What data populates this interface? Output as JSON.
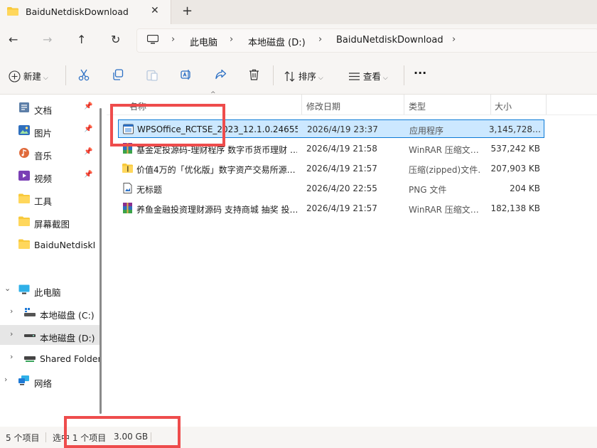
{
  "tab": {
    "title": "BaiduNetdiskDownload",
    "close": "✕",
    "new": "+"
  },
  "nav": {
    "back": "←",
    "forward": "→",
    "up": "↑",
    "refresh": "↻",
    "breadcrumbs": [
      "此电脑",
      "本地磁盘 (D:)",
      "BaiduNetdiskDownload"
    ],
    "sep": "›"
  },
  "toolbar": {
    "new_label": "新建",
    "sort_label": "排序",
    "view_label": "查看",
    "more": "···"
  },
  "sidebar": {
    "quick": [
      {
        "label": "文档",
        "icon": "documents-icon",
        "pinned": true
      },
      {
        "label": "图片",
        "icon": "pictures-icon",
        "pinned": true
      },
      {
        "label": "音乐",
        "icon": "music-icon",
        "pinned": true
      },
      {
        "label": "视频",
        "icon": "videos-icon",
        "pinned": true
      },
      {
        "label": "工具",
        "icon": "folder-icon",
        "pinned": false
      },
      {
        "label": "屏幕截图",
        "icon": "folder-icon",
        "pinned": false
      },
      {
        "label": "BaiduNetdiskDownload",
        "icon": "folder-icon",
        "pinned": false
      }
    ],
    "this_pc": "此电脑",
    "drives": [
      {
        "label": "本地磁盘 (C:)",
        "icon": "drive-c-icon"
      },
      {
        "label": "本地磁盘 (D:)",
        "icon": "drive-d-icon",
        "selected": true
      },
      {
        "label": "Shared Folders",
        "icon": "network-drive-icon"
      }
    ],
    "network": "网络"
  },
  "columns": {
    "name": "名称",
    "modified": "修改日期",
    "type": "类型",
    "size": "大小"
  },
  "files": [
    {
      "name": "WPSOffice_RCTSE_2023_12.1.0.24655_…",
      "modified": "2026/4/19 23:37",
      "type": "应用程序",
      "size": "3,145,728…",
      "icon": "exe-icon",
      "selected": true
    },
    {
      "name": "基金定投源码-理财程序 数字币货币理财 …",
      "modified": "2026/4/19 21:58",
      "type": "WinRAR 压缩文…",
      "size": "537,242 KB",
      "icon": "winrar-icon"
    },
    {
      "name": "价值4万的「优化版」数字资产交易所源…",
      "modified": "2026/4/19 21:57",
      "type": "压缩(zipped)文件…",
      "size": "207,903 KB",
      "icon": "zip-folder-icon"
    },
    {
      "name": "无标题",
      "modified": "2026/4/20 22:55",
      "type": "PNG 文件",
      "size": "204 KB",
      "icon": "png-file-icon"
    },
    {
      "name": "养鱼金融投资理财源码 支持商城 抽奖 投…",
      "modified": "2026/4/19 21:57",
      "type": "WinRAR 压缩文…",
      "size": "182,138 KB",
      "icon": "winrar-icon"
    }
  ],
  "status": {
    "count": "5 个项目",
    "selection": "选中 1 个项目",
    "size": "3.00 GB"
  },
  "colors": {
    "highlight": "#ee4c4c",
    "selection_bg": "#cce8ff",
    "selection_border": "#0b7ad6"
  }
}
